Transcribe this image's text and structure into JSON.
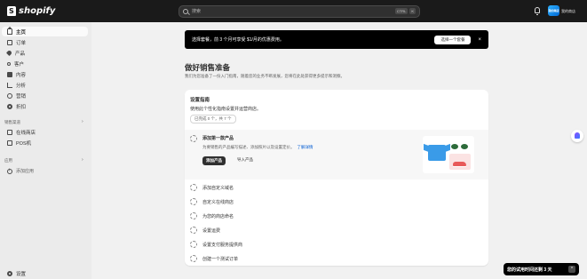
{
  "topbar": {
    "brand": "shopify",
    "search_placeholder": "搜索",
    "shortcut_keys": [
      "CTRL",
      "K"
    ],
    "store_initials": "我的商店",
    "store_name": "我的商店"
  },
  "sidebar": {
    "items": [
      {
        "label": "主页",
        "icon": "home-icon"
      },
      {
        "label": "订单",
        "icon": "inbox-icon"
      },
      {
        "label": "产品",
        "icon": "tag-icon"
      },
      {
        "label": "客户",
        "icon": "person-icon"
      },
      {
        "label": "内容",
        "icon": "document-icon"
      },
      {
        "label": "分析",
        "icon": "bar-chart-icon"
      },
      {
        "label": "营销",
        "icon": "target-icon"
      },
      {
        "label": "折扣",
        "icon": "discount-icon"
      }
    ],
    "sales_channels_label": "销售渠道",
    "channels": [
      {
        "label": "在线商店",
        "icon": "store-icon"
      },
      {
        "label": "POS机",
        "icon": "pos-icon"
      }
    ],
    "apps_label": "应用",
    "add_app": "添加应用",
    "settings": "设置"
  },
  "banner": {
    "text": "选择套餐，前 3 个月可享受 $1/月的优惠费用。",
    "button": "选择一个套餐",
    "close": "×"
  },
  "page": {
    "title": "做好销售准备",
    "subtitle": "我们为您准备了一份入门指南，随着您的业务不断发展，您将在此处获得更多提示和洞察。"
  },
  "guide": {
    "title": "设置指南",
    "description": "使用此个性化指南设置并运营商店。",
    "progress": "已完成 0 个，共 7 个",
    "expanded_task": {
      "title": "添加第一款产品",
      "description": "为要销售的产品编写描述、添加照片以及设置定价。",
      "learn_more": "了解详情",
      "primary_button": "添加产品",
      "secondary_button": "导入产品"
    },
    "tasks": [
      "添加自定义域名",
      "自定义在线商店",
      "为您的商店命名",
      "设置运费",
      "设置支付服务提供商",
      "创建一个测试订单"
    ]
  },
  "trial": {
    "text": "您的试用时间还剩 3 天",
    "toggle": "^"
  }
}
